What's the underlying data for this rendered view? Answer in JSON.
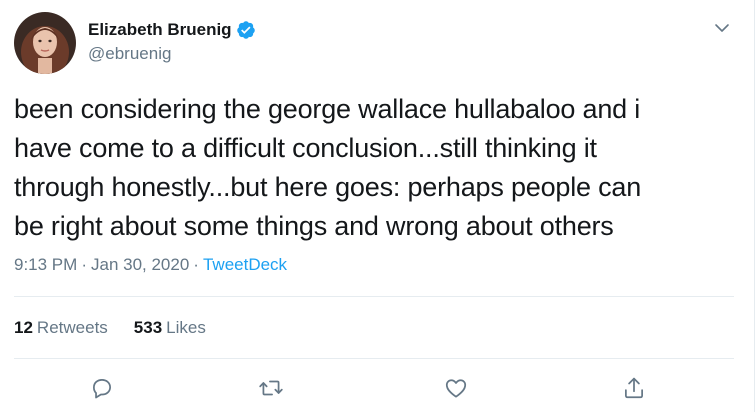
{
  "author": {
    "display_name": "Elizabeth Bruenig",
    "handle": "@ebruenig",
    "verified": true
  },
  "tweet": {
    "text_lines": [
      "been considering the george wallace hullabaloo and i",
      "have come to a difficult conclusion...still thinking it",
      "through honestly...but here goes: perhaps people can",
      "be right about some things and wrong about others"
    ],
    "time": "9:13 PM",
    "date": "Jan 30, 2020",
    "separator": "·",
    "source": "TweetDeck"
  },
  "stats": {
    "retweets_count": "12",
    "retweets_label": "Retweets",
    "likes_count": "533",
    "likes_label": "Likes"
  },
  "actions": {
    "reply_icon": "reply-icon",
    "retweet_icon": "retweet-icon",
    "like_icon": "heart-icon",
    "share_icon": "share-icon"
  },
  "colors": {
    "accent": "#1da1f2",
    "text_primary": "#14171a",
    "text_secondary": "#657786",
    "divider": "#e6ecf0"
  }
}
